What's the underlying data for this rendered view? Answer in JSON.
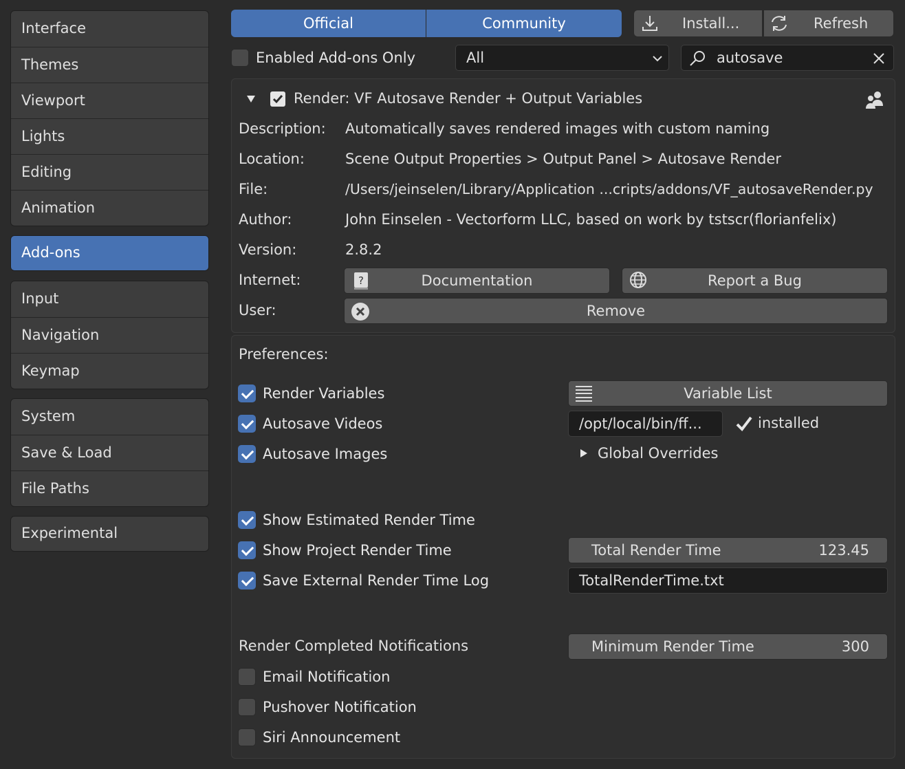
{
  "sidebar": {
    "group1": [
      "Interface",
      "Themes",
      "Viewport",
      "Lights",
      "Editing",
      "Animation"
    ],
    "group2": [
      "Add-ons"
    ],
    "group3": [
      "Input",
      "Navigation",
      "Keymap"
    ],
    "group4": [
      "System",
      "Save & Load",
      "File Paths"
    ],
    "group5": [
      "Experimental"
    ]
  },
  "toolbar": {
    "official": "Official",
    "community": "Community",
    "install": "Install...",
    "refresh": "Refresh",
    "enabled_only": "Enabled Add-ons Only",
    "category": "All",
    "search": "autosave"
  },
  "addon": {
    "title": "Render: VF Autosave Render + Output Variables",
    "description_label": "Description:",
    "description": "Automatically saves rendered images with custom naming",
    "location_label": "Location:",
    "location": "Scene Output Properties > Output Panel > Autosave Render",
    "file_label": "File:",
    "file": "/Users/jeinselen/Library/Application ...cripts/addons/VF_autosaveRender.py",
    "author_label": "Author:",
    "author": "John Einselen - Vectorform LLC, based on work by tstscr(florianfelix)",
    "version_label": "Version:",
    "version": "2.8.2",
    "internet_label": "Internet:",
    "documentation": "Documentation",
    "report_bug": "Report a Bug",
    "user_label": "User:",
    "remove": "Remove"
  },
  "prefs": {
    "heading": "Preferences:",
    "render_variables": "Render Variables",
    "variable_list": "Variable List",
    "autosave_videos": "Autosave Videos",
    "ffmpeg_path": "/opt/local/bin/ff...",
    "installed": "installed",
    "autosave_images": "Autosave Images",
    "global_overrides": "Global Overrides",
    "show_estimated": "Show Estimated Render Time",
    "show_project": "Show Project Render Time",
    "total_render_time_label": "Total Render Time",
    "total_render_time_value": "123.45",
    "save_external_log": "Save External Render Time Log",
    "log_file": "TotalRenderTime.txt",
    "notifications_heading": "Render Completed Notifications",
    "min_render_time_label": "Minimum Render Time",
    "min_render_time_value": "300",
    "email": "Email Notification",
    "pushover": "Pushover Notification",
    "siri": "Siri Announcement"
  },
  "colors": {
    "accent": "#4772b3",
    "background": "#2b2b2b",
    "button": "#545454"
  }
}
